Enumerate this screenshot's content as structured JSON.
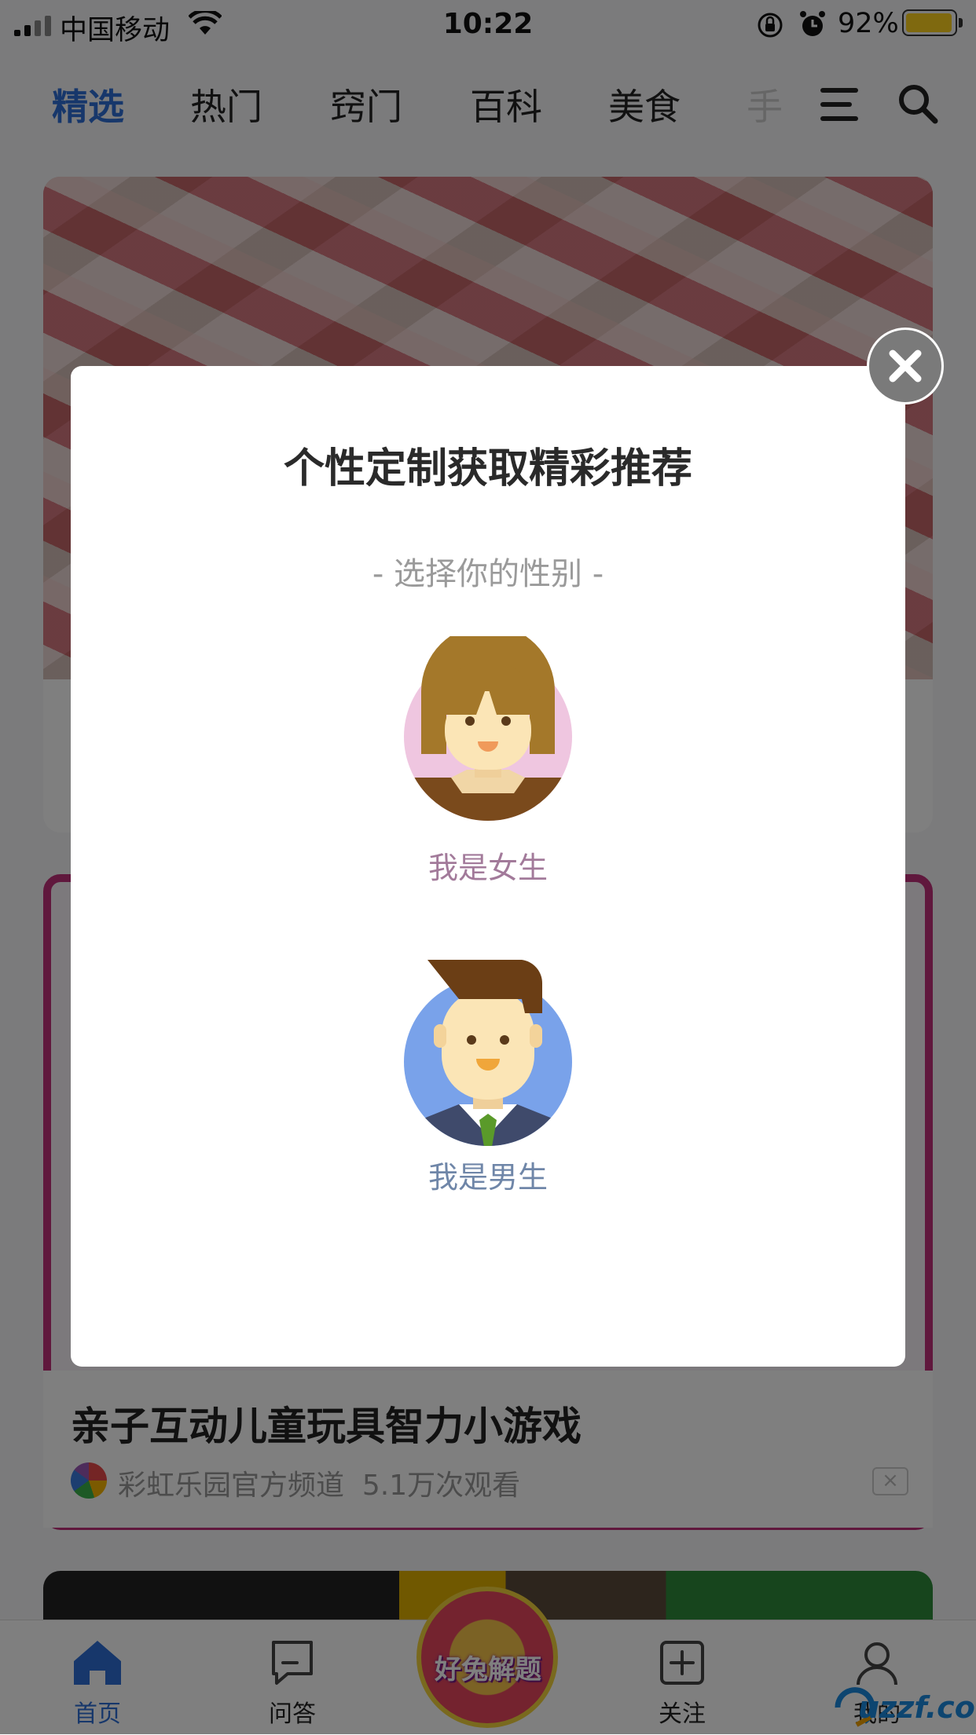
{
  "status_bar": {
    "carrier": "中国移动",
    "time": "10:22",
    "battery_percent": "92%",
    "battery_level": 0.88,
    "icons": [
      "signal-icon",
      "wifi-icon",
      "rotation-lock-icon",
      "alarm-icon",
      "battery-icon"
    ]
  },
  "tabs": {
    "items": [
      "精选",
      "热门",
      "窍门",
      "百科",
      "美食",
      "手工"
    ],
    "active": "精选"
  },
  "feed": {
    "video": {
      "title": "亲子互动儿童玩具智力小游戏",
      "channel": "彩虹乐园官方频道",
      "views": "5.1万次观看",
      "dismiss": "×"
    }
  },
  "bottom_nav": {
    "items": [
      "首页",
      "问答",
      "关注",
      "我的"
    ],
    "active": "首页",
    "promo_label": "好兔解题"
  },
  "watermark": "uzzf.com",
  "modal": {
    "title": "个性定制获取精彩推荐",
    "subtitle": "- 选择你的性别 -",
    "female_label": "我是女生",
    "male_label": "我是男生",
    "close_icon": "close-icon"
  },
  "colors": {
    "accent": "#2f6fd6",
    "female": "#a27a9a",
    "male": "#6f86a8",
    "battery": "#ffd21f"
  }
}
